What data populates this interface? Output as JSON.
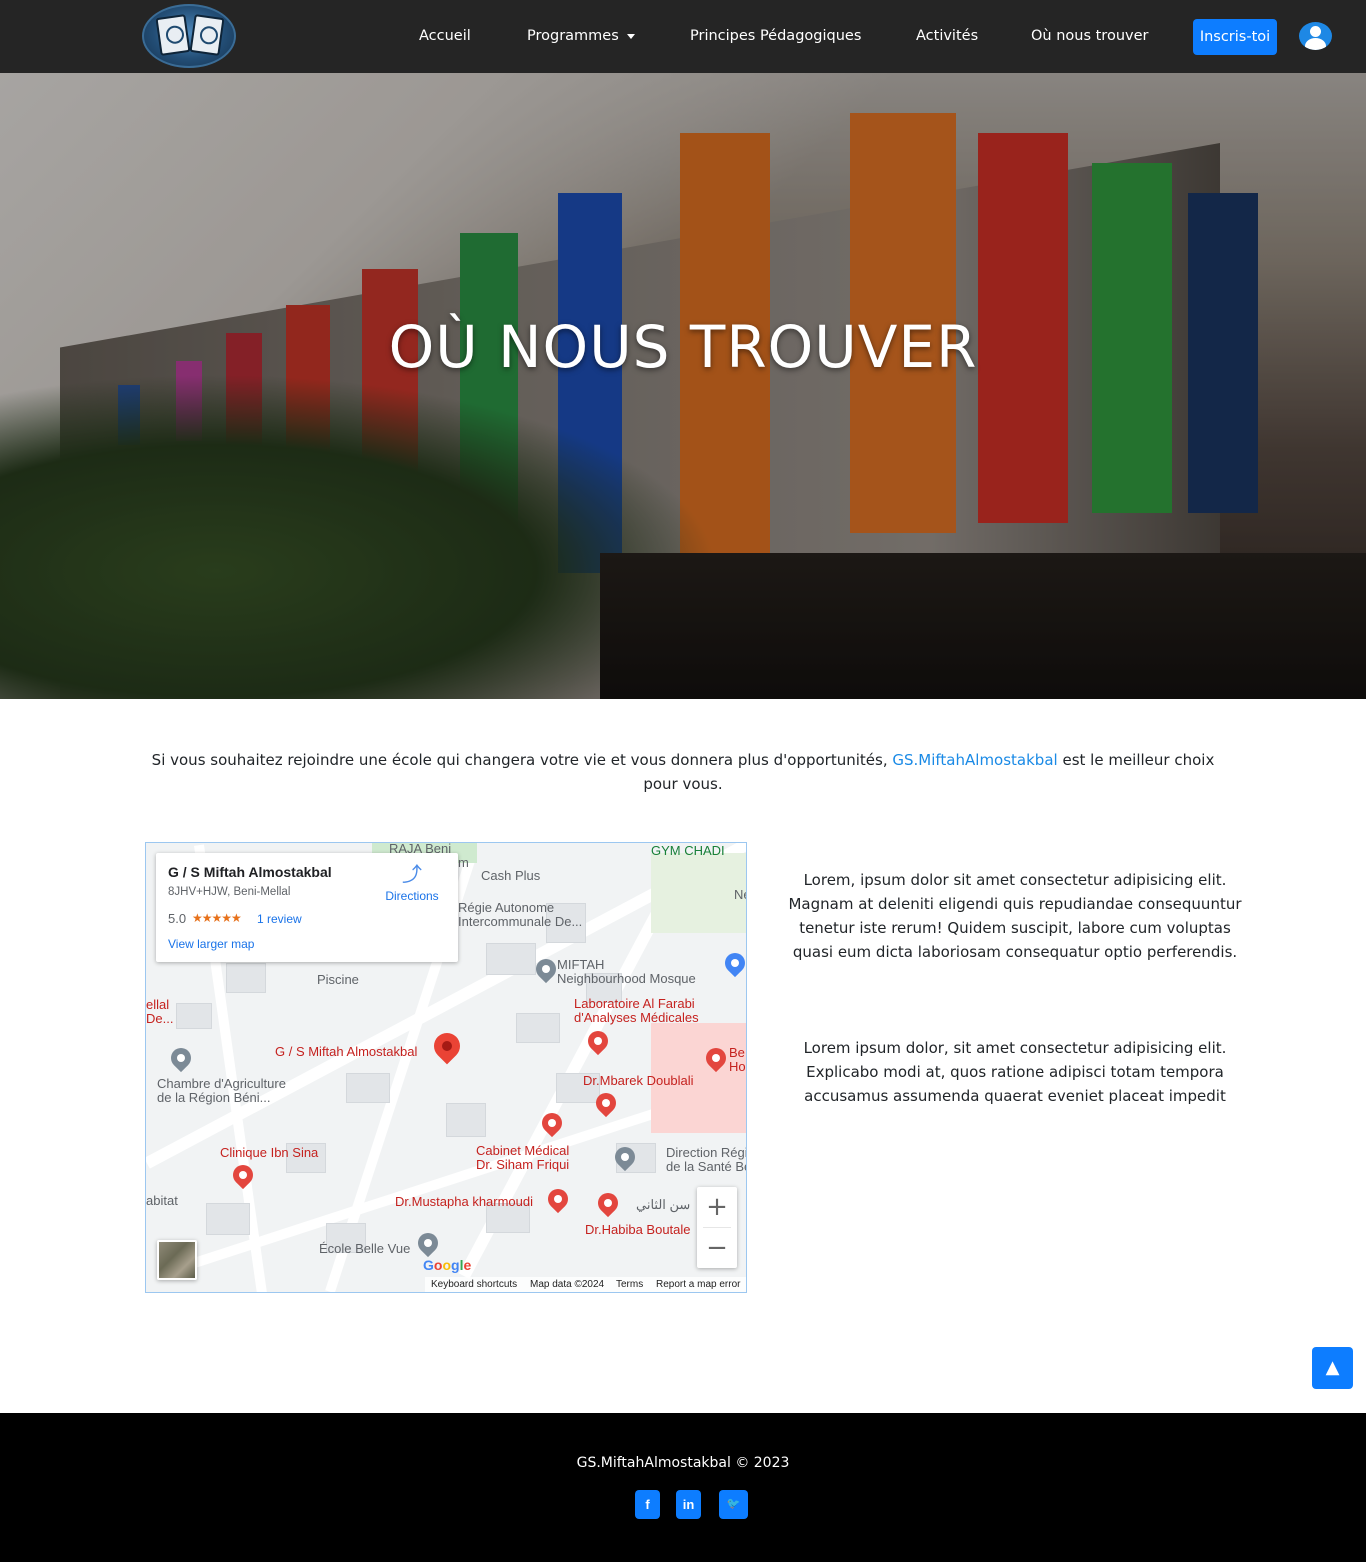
{
  "nav": {
    "links": [
      {
        "label": "Accueil"
      },
      {
        "label": "Programmes"
      },
      {
        "label": "Principes Pédagogiques"
      },
      {
        "label": "Activités"
      },
      {
        "label": "Où nous trouver"
      }
    ],
    "cta_label": "Inscris-toi"
  },
  "hero": {
    "title": "OÙ NOUS TROUVER"
  },
  "intro": {
    "text_before": "Si vous souhaitez rejoindre une école qui changera votre vie et vous donnera plus d'opportunités,",
    "link_text": "GS.MiftahAlmostakbal",
    "text_after": "est le meilleur choix pour vous."
  },
  "map": {
    "card": {
      "name": "G / S Miftah Almostakbal",
      "address": "8JHV+HJW, Beni-Mellal",
      "rating": "5.0",
      "stars": "★★★★★",
      "reviews": "1 review",
      "view_larger": "View larger map",
      "directions": "Directions"
    },
    "places": [
      {
        "label": "RAJA Beni"
      },
      {
        "label": "m"
      },
      {
        "label": "Cash Plus"
      },
      {
        "label": "GYM CHADI"
      },
      {
        "label": "Ne"
      },
      {
        "label": "Régie Autonome"
      },
      {
        "label": "Intercommunale De..."
      },
      {
        "label": "Piscine"
      },
      {
        "label": "MIFTAH"
      },
      {
        "label": "Neighbourhood Mosque"
      },
      {
        "label": "ellal"
      },
      {
        "label": "De..."
      },
      {
        "label": "Laboratoire Al Farabi"
      },
      {
        "label": "d'Analyses Médicales"
      },
      {
        "label": "G / S Miftah Almostakbal"
      },
      {
        "label": "Be"
      },
      {
        "label": "Ho"
      },
      {
        "label": "Chambre d'Agriculture"
      },
      {
        "label": "de la Région Béni..."
      },
      {
        "label": "Dr.Mbarek Doublali"
      },
      {
        "label": "Clinique Ibn Sina"
      },
      {
        "label": "Cabinet Médical"
      },
      {
        "label": "Dr. Siham Friqui"
      },
      {
        "label": "Direction Régiona"
      },
      {
        "label": "de la Santé Béni M"
      },
      {
        "label": "abitat"
      },
      {
        "label": "Dr.Mustapha kharmoudi"
      },
      {
        "label": "Dr.Habiba Boutale"
      },
      {
        "label": "سن الثاني"
      },
      {
        "label": "École Belle Vue"
      }
    ],
    "zoom_in": "+",
    "zoom_out": "−",
    "google": "Google",
    "footer": {
      "shortcuts": "Keyboard shortcuts",
      "data": "Map data ©2024",
      "terms": "Terms",
      "report": "Report a map error"
    }
  },
  "paragraphs": [
    "Lorem, ipsum dolor sit amet consectetur adipisicing elit. Magnam at deleniti eligendi quis repudiandae consequuntur tenetur iste rerum! Quidem suscipit, labore cum voluptas quasi eum dicta laboriosam consequatur optio perferendis.",
    "Lorem ipsum dolor, sit amet consectetur adipisicing elit. Explicabo modi at, quos ratione adipisci totam tempora accusamus assumenda quaerat eveniet placeat impedit"
  ],
  "back_to_top_icon": "arrow-up-icon",
  "footer": {
    "copyright": "GS.MiftahAlmostakbal © 2023",
    "social": [
      {
        "icon": "facebook-icon",
        "glyph": "f"
      },
      {
        "icon": "linkedin-icon",
        "glyph": "in"
      },
      {
        "icon": "twitter-icon",
        "glyph": "🐦"
      }
    ]
  },
  "colors": {
    "accent": "#0d7dff",
    "navbar": "#252525",
    "link": "#1a8ae6",
    "footer": "#000000"
  }
}
